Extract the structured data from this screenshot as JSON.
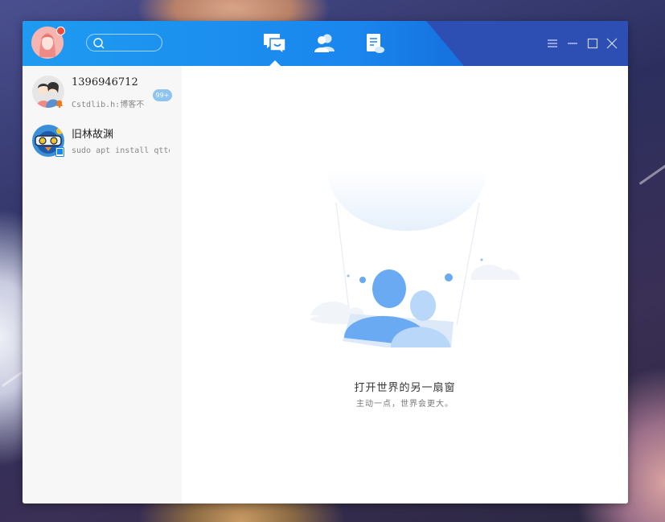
{
  "window": {
    "accent_color": "#1a86ee",
    "header_dark_color": "#2d4fb4"
  },
  "header": {
    "search_placeholder": "",
    "tabs": [
      {
        "icon": "chat-bubble-icon",
        "active": true
      },
      {
        "icon": "contacts-icon",
        "active": false
      },
      {
        "icon": "document-icon",
        "active": false
      }
    ],
    "controls": [
      "menu-icon",
      "minimize-icon",
      "maximize-icon",
      "close-icon"
    ]
  },
  "contacts": [
    {
      "name": "1396946712",
      "last_message": "Cstdlib.h:博客不",
      "badge": "99+",
      "avatar_icon": "couple-avatar-icon"
    },
    {
      "name": "旧林故渊",
      "last_message": "sudo apt install qttoo",
      "badge": "",
      "avatar_icon": "game-avatar-icon"
    }
  ],
  "main": {
    "empty_title": "打开世界的另一扇窗",
    "empty_subtitle": "主动一点，世界会更大。",
    "illustration_icon": "hot-air-balloon-people-icon"
  }
}
